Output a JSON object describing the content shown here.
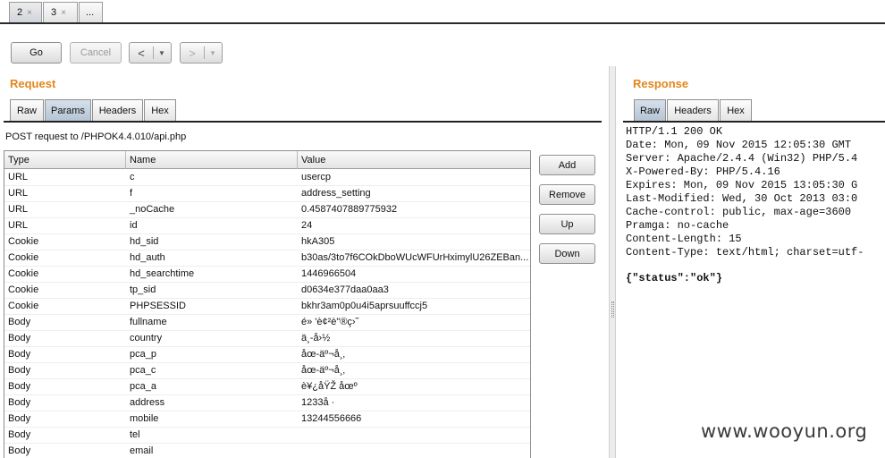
{
  "top_tabs": [
    {
      "label": "2",
      "close": "×"
    },
    {
      "label": "3",
      "close": "×"
    },
    {
      "label": "..."
    }
  ],
  "toolbar": {
    "go": "Go",
    "cancel": "Cancel",
    "back_arrow": "<",
    "forward_arrow": ">",
    "dropdown": "▼"
  },
  "request": {
    "title": "Request",
    "tabs": [
      "Raw",
      "Params",
      "Headers",
      "Hex"
    ],
    "active_tab": "Params",
    "post_line": "POST request to /PHPOK4.4.010/api.php",
    "columns": [
      "Type",
      "Name",
      "Value"
    ],
    "rows": [
      {
        "type": "URL",
        "name": "c",
        "value": "usercp"
      },
      {
        "type": "URL",
        "name": "f",
        "value": "address_setting"
      },
      {
        "type": "URL",
        "name": "_noCache",
        "value": "0.4587407889775932"
      },
      {
        "type": "URL",
        "name": "id",
        "value": "24"
      },
      {
        "type": "Cookie",
        "name": "hd_sid",
        "value": "hkA305"
      },
      {
        "type": "Cookie",
        "name": "hd_auth",
        "value": "b30as/3to7f6COkDboWUcWFUrHximylU26ZEBan..."
      },
      {
        "type": "Cookie",
        "name": "hd_searchtime",
        "value": "1446966504"
      },
      {
        "type": "Cookie",
        "name": "tp_sid",
        "value": "d0634e377daa0aa3"
      },
      {
        "type": "Cookie",
        "name": "PHPSESSID",
        "value": "bkhr3am0p0u4i5aprsuuffccj5"
      },
      {
        "type": "Body",
        "name": "fullname",
        "value": "é» 'è¢²è\"®ç›˜"
      },
      {
        "type": "Body",
        "name": "country",
        "value": "ä¸-å›½"
      },
      {
        "type": "Body",
        "name": "pca_p",
        "value": "åœ-äº¬å¸‚"
      },
      {
        "type": "Body",
        "name": "pca_c",
        "value": "åœ-äº¬å¸‚"
      },
      {
        "type": "Body",
        "name": "pca_a",
        "value": "è¥¿åŸŽ åœº"
      },
      {
        "type": "Body",
        "name": "address",
        "value": "1233å ·"
      },
      {
        "type": "Body",
        "name": "mobile",
        "value": "13244556666"
      },
      {
        "type": "Body",
        "name": "tel",
        "value": ""
      },
      {
        "type": "Body",
        "name": "email",
        "value": ""
      }
    ],
    "side_buttons": [
      "Add",
      "Remove",
      "Up",
      "Down"
    ]
  },
  "response": {
    "title": "Response",
    "tabs": [
      "Raw",
      "Headers",
      "Hex"
    ],
    "active_tab": "Raw",
    "lines": [
      "HTTP/1.1 200 OK",
      "Date: Mon, 09 Nov 2015 12:05:30 GMT",
      "Server: Apache/2.4.4 (Win32) PHP/5.4",
      "X-Powered-By: PHP/5.4.16",
      "Expires: Mon, 09 Nov 2015 13:05:30 G",
      "Last-Modified: Wed, 30 Oct 2013 03:0",
      "Cache-control: public, max-age=3600",
      "Pramga: no-cache",
      "Content-Length: 15",
      "Content-Type: text/html; charset=utf-"
    ],
    "body": "{\"status\":\"ok\"}"
  },
  "watermark": "www.wooyun.org",
  "colors": {
    "section_title": "#e3861c",
    "active_tab": "#b4c4d4"
  }
}
